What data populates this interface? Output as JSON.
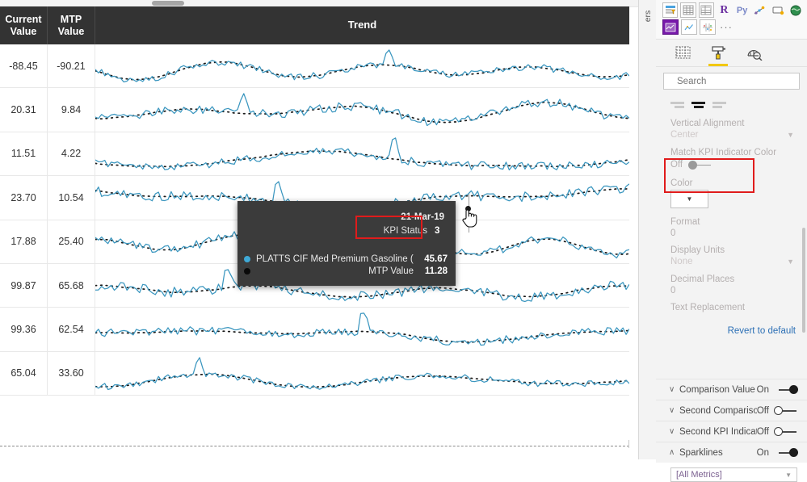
{
  "matrix": {
    "columns": [
      "Current Value",
      "MTP Value",
      "Trend"
    ],
    "rows": [
      {
        "current": "-88.45",
        "mtp": "-90.21"
      },
      {
        "current": "20.31",
        "mtp": "9.84"
      },
      {
        "current": "11.51",
        "mtp": "4.22"
      },
      {
        "current": "23.70",
        "mtp": "10.54"
      },
      {
        "current": "17.88",
        "mtp": "25.40"
      },
      {
        "current": "99.87",
        "mtp": "65.68"
      },
      {
        "current": "99.36",
        "mtp": "62.54"
      },
      {
        "current": "65.04",
        "mtp": "33.60"
      }
    ],
    "sparkline_color": "#3a96bf",
    "reference_line_color": "#1a1a1a",
    "header_background": "#333333"
  },
  "tooltip": {
    "date": "21-Mar-19",
    "kpi_status_label": "KPI Status",
    "kpi_status_value": "3",
    "series": [
      {
        "name": "PLATTS CIF Med Premium Gasoline (F-A)",
        "value": "45.67",
        "color": "#3fa9d6"
      },
      {
        "name": "MTP Value",
        "value": "11.28",
        "color": "#0a0a0a"
      }
    ],
    "highlight_color": "#e01b1b"
  },
  "filters_rail": {
    "label": "ers"
  },
  "pane": {
    "gallery": {
      "row1": [
        "stacked-bar-filter-icon",
        "table-icon",
        "matrix-icon",
        "R",
        "Py",
        "key-influencers-icon",
        "decomposition-tree-icon",
        "arcgis-map-icon"
      ],
      "row2": [
        "kpi-matrix-icon",
        "line-chart-custom-icon",
        "scatter-matrix-icon",
        "···"
      ]
    },
    "tabs": [
      {
        "name": "fields-tab",
        "selected": false
      },
      {
        "name": "format-tab",
        "selected": true
      },
      {
        "name": "analytics-tab",
        "selected": false
      }
    ],
    "search": {
      "placeholder": "Search",
      "value": ""
    },
    "format": {
      "alignment": {
        "selected": "center"
      },
      "vertical_alignment_label": "Vertical Alignment",
      "vertical_alignment_value": "Center",
      "match_kpi_label": "Match KPI Indicator Color",
      "match_kpi_state": "Off",
      "color_label": "Color",
      "format_label": "Format",
      "format_value": "0",
      "display_units_label": "Display Units",
      "display_units_value": "None",
      "decimal_places_label": "Decimal Places",
      "decimal_places_value": "0",
      "text_replacement_label": "Text Replacement",
      "revert_label": "Revert to default"
    },
    "cards": [
      {
        "title": "Comparison Value",
        "state": "On",
        "expanded": false
      },
      {
        "title": "Second Comparison V...",
        "state": "Off",
        "expanded": false
      },
      {
        "title": "Second KPI Indicator ...",
        "state": "Off",
        "expanded": false
      },
      {
        "title": "Sparklines",
        "state": "On",
        "expanded": true
      }
    ],
    "sparklines_metric": "[All Metrics]",
    "accent_color": "#f2c811"
  }
}
